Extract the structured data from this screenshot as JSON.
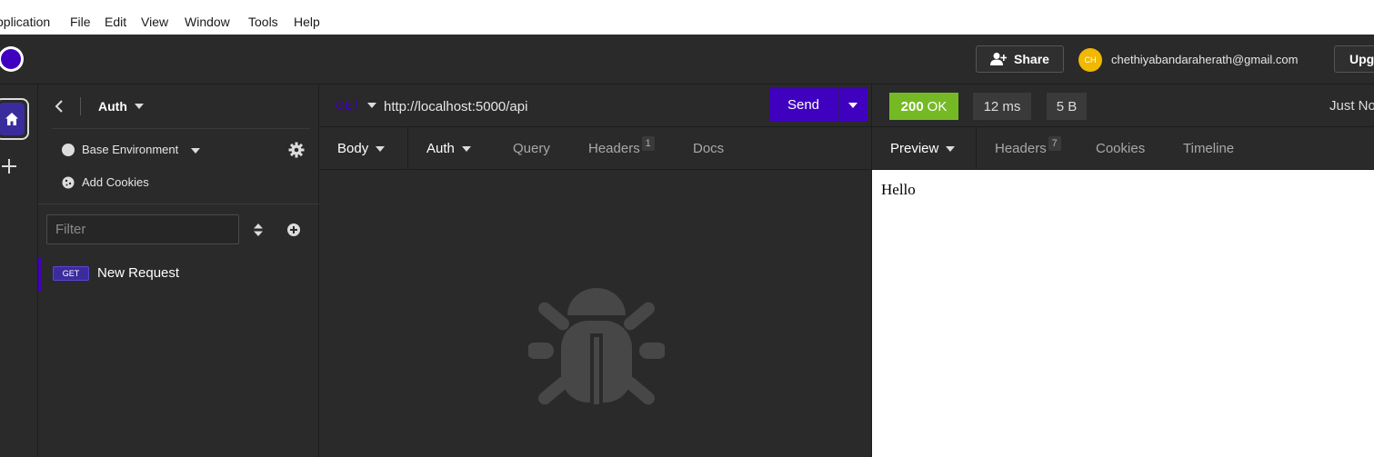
{
  "menubar": {
    "items": [
      "pplication",
      "File",
      "Edit",
      "View",
      "Window",
      "Tools",
      "Help"
    ]
  },
  "topbar": {
    "share_label": "Share",
    "avatar_initials": "CH",
    "user_email": "chethiyabandaraherath@gmail.com",
    "upgrade_label": "Upg"
  },
  "sidebar": {
    "title": "Auth",
    "environment_label": "Base Environment",
    "cookies_label": "Add Cookies",
    "filter_placeholder": "Filter",
    "requests": [
      {
        "method": "GET",
        "name": "New Request"
      }
    ]
  },
  "request": {
    "method": "GET",
    "url": "http://localhost:5000/api",
    "send_label": "Send",
    "tabs": {
      "body": "Body",
      "auth": "Auth",
      "query": "Query",
      "headers": "Headers",
      "headers_count": "1",
      "docs": "Docs"
    }
  },
  "response": {
    "status_code": "200",
    "status_text": "OK",
    "time": "12 ms",
    "size": "5 B",
    "timestamp": "Just No",
    "tabs": {
      "preview": "Preview",
      "headers": "Headers",
      "headers_count": "7",
      "cookies": "Cookies",
      "timeline": "Timeline"
    },
    "body_text": "Hello"
  },
  "colors": {
    "accent": "#4000bf",
    "success": "#75ba24",
    "background": "#2a2a2a",
    "avatar": "#f0b800"
  },
  "icons": [
    "logo-icon",
    "share-person-icon",
    "home-icon",
    "plus-icon",
    "back-chevron-icon",
    "gear-icon",
    "cookie-icon",
    "sort-icon",
    "add-circle-icon",
    "bug-icon"
  ]
}
